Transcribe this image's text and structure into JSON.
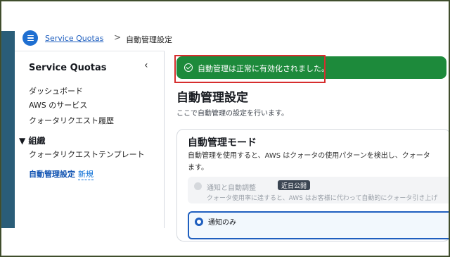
{
  "breadcrumb": {
    "root": "Service Quotas",
    "separator": ">",
    "current": "自動管理設定"
  },
  "icons": {
    "menu": "hamburger-menu-icon",
    "collapse": "chevron-left-icon",
    "section_toggle": "caret-down-icon",
    "success": "check-circle-icon"
  },
  "sidebar": {
    "title": "Service Quotas",
    "collapse_glyph": "‹",
    "items": [
      "ダッシュボード",
      "AWS のサービス",
      "クォータリクエスト履歴"
    ],
    "section": {
      "label": "▼ 組織",
      "items": [
        "クォータリクエストテンプレート"
      ]
    },
    "active_item": "自動管理設定",
    "active_badge": "新規"
  },
  "flash": {
    "message": "自動管理は正常に有効化されました。",
    "color": "#1d8a3b"
  },
  "page": {
    "title": "自動管理設定",
    "description": "ここで自動管理の設定を行います。"
  },
  "card": {
    "title": "自動管理モード",
    "description_line1": "自動管理を使用すると、AWS はクォータの使用パターンを検出し、クォータ",
    "description_line2": "ます。",
    "options": [
      {
        "label": "通知と自動調整",
        "badge": "近日公開",
        "description": "クォータ使用率に達すると、AWS はお客様に代わって自動的にクォータ引き上げ",
        "state": "disabled"
      },
      {
        "label": "通知のみ",
        "state": "selected"
      }
    ]
  },
  "colors": {
    "accent": "#1f5fbf",
    "highlight_box": "#d62d2d"
  }
}
